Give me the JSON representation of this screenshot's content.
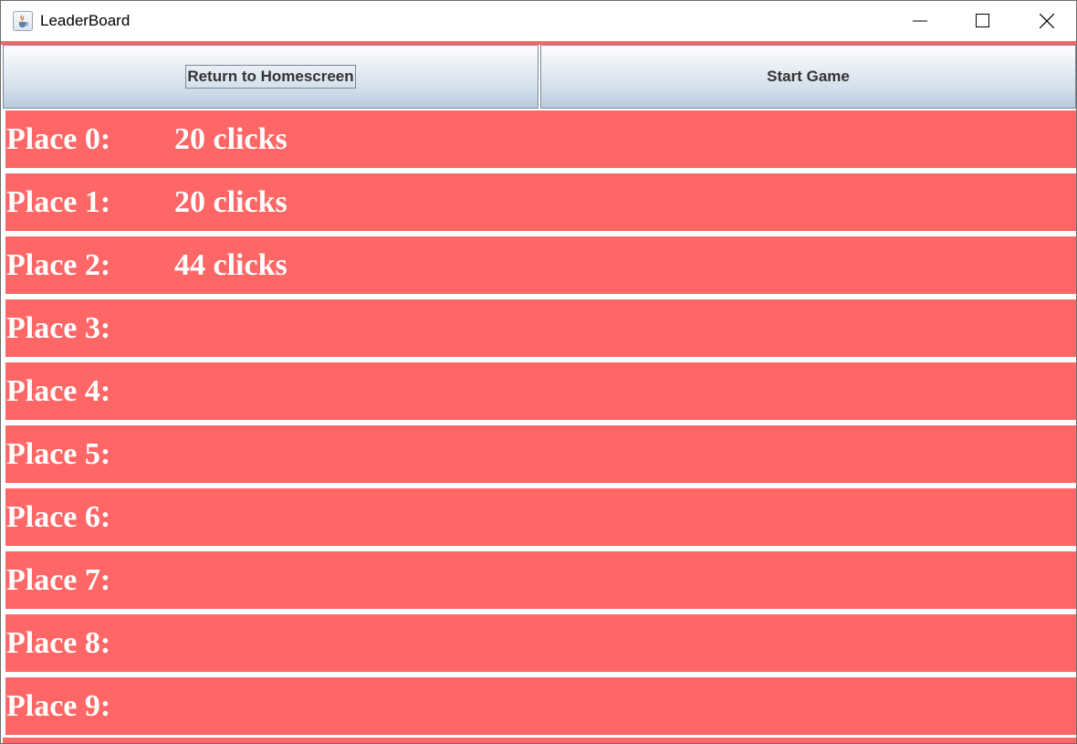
{
  "window": {
    "title": "LeaderBoard",
    "icon": "java-cup-icon"
  },
  "toolbar": {
    "home_label": "Return to Homescreen",
    "start_label": "Start Game"
  },
  "leaderboard": {
    "rows": [
      {
        "place": "Place 0:",
        "score": "20 clicks"
      },
      {
        "place": "Place 1:",
        "score": "20 clicks"
      },
      {
        "place": "Place 2:",
        "score": "44 clicks"
      },
      {
        "place": "Place 3:",
        "score": ""
      },
      {
        "place": "Place 4:",
        "score": ""
      },
      {
        "place": "Place 5:",
        "score": ""
      },
      {
        "place": "Place 6:",
        "score": ""
      },
      {
        "place": "Place 7:",
        "score": ""
      },
      {
        "place": "Place 8:",
        "score": ""
      },
      {
        "place": "Place 9:",
        "score": ""
      }
    ]
  },
  "colors": {
    "row_background": "#ff6666",
    "row_text": "#ffffff",
    "button_text": "#333333"
  }
}
